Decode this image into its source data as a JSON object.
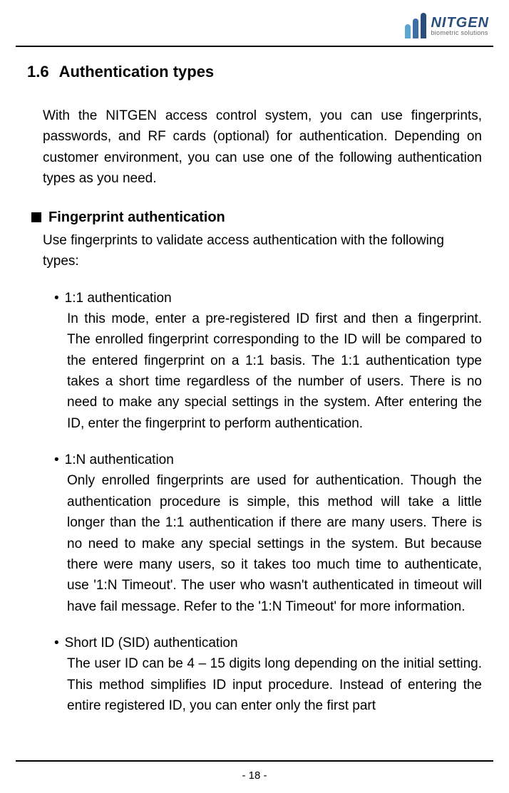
{
  "header": {
    "logo_name": "NITGEN",
    "logo_tagline": "biometric solutions"
  },
  "section": {
    "number": "1.6",
    "title": "Authentication types",
    "intro": "With the NITGEN access control system, you can use fingerprints, passwords, and RF cards (optional) for authentication. Depending on customer environment, you can use one of the following authentication types as you need."
  },
  "subsection": {
    "title": "Fingerprint authentication",
    "intro": "Use fingerprints to validate access authentication with the following types:"
  },
  "items": [
    {
      "title": "1:1 authentication",
      "body": "In this mode, enter a pre-registered ID first and then a fingerprint. The enrolled fingerprint corresponding to the ID will be compared to the entered fingerprint on a 1:1 basis. The 1:1 authentication type takes a short time regardless of the number of users. There is no need to make any special settings in the system. After entering the ID, enter the fingerprint to perform authentication."
    },
    {
      "title": "1:N authentication",
      "body": "Only enrolled fingerprints are used for authentication. Though the authentication procedure is simple, this method will take a little longer than the 1:1 authentication if there are many users. There is no need to make any special settings in the system. But because there were many users, so it takes too much time to authenticate, use '1:N Timeout'. The user who wasn't authenticated in timeout will have fail message. Refer to the '1:N Timeout' for more information."
    },
    {
      "title": "Short ID (SID) authentication",
      "body": "The user ID can be 4 – 15 digits long depending on the initial setting. This method simplifies ID input procedure. Instead of entering the entire registered ID, you can enter only the first part"
    }
  ],
  "footer": {
    "page": "- 18 -"
  }
}
